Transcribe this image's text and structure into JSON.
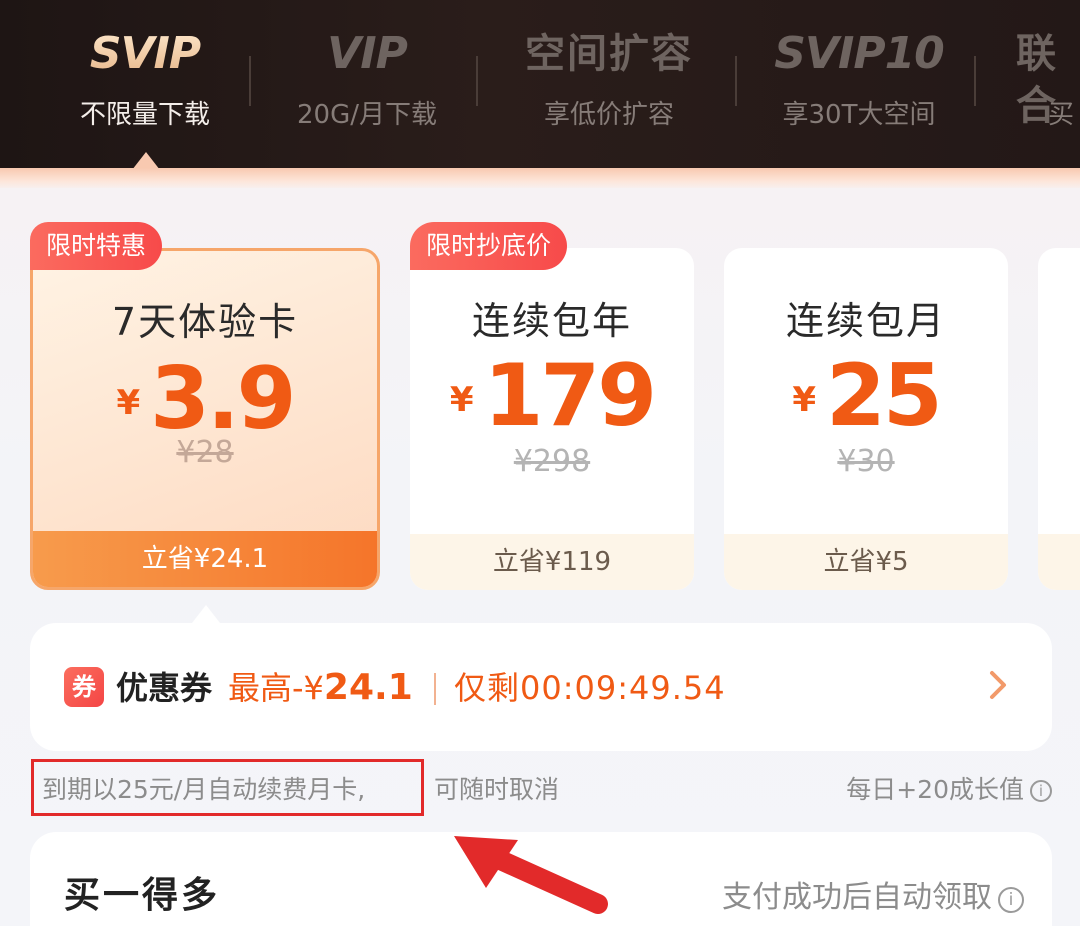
{
  "tabs": [
    {
      "title": "SVIP",
      "subtitle": "不限量下载",
      "active": true
    },
    {
      "title": "VIP",
      "subtitle": "20G/月下载",
      "active": false
    },
    {
      "title": "空间扩容",
      "subtitle": "享低价扩容",
      "active": false
    },
    {
      "title": "SVIP10",
      "subtitle": "享30T大空间",
      "active": false
    },
    {
      "title": "联合",
      "subtitle": "买",
      "active": false
    }
  ],
  "plans": [
    {
      "badge": "限时特惠",
      "name": "7天体验卡",
      "currency": "¥",
      "price": "3.9",
      "original": "¥28",
      "save": "立省¥24.1",
      "selected": true
    },
    {
      "badge": "限时抄底价",
      "name": "连续包年",
      "currency": "¥",
      "price": "179",
      "original": "¥298",
      "save": "立省¥119",
      "selected": false
    },
    {
      "badge": "",
      "name": "连续包月",
      "currency": "¥",
      "price": "25",
      "original": "¥30",
      "save": "立省¥5",
      "selected": false
    }
  ],
  "coupon": {
    "tag": "券",
    "label": "优惠券",
    "max_prefix": "最高-¥",
    "max_amount": "24.1",
    "timer": "仅剩00:09:49.54",
    "arrow_icon": "chevron-right-icon"
  },
  "renewal": {
    "note": "到期以25元/月自动续费月卡,",
    "cancel": "可随时取消",
    "growth": "每日+20成长值"
  },
  "bottom": {
    "title": "买一得多",
    "hint": "支付成功后自动领取"
  },
  "colors": {
    "accent": "#f05a14",
    "highlight_box": "#e22a2a",
    "badge": "#f74a4a",
    "save_bar": "#f5752a"
  }
}
